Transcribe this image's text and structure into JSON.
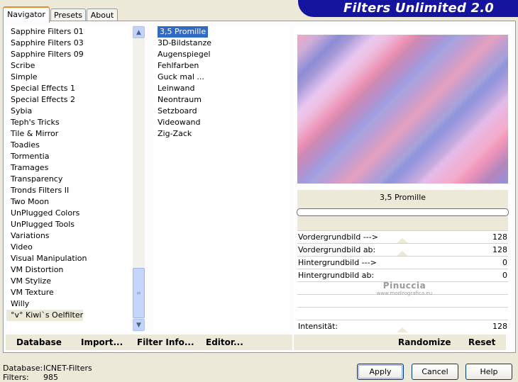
{
  "app": {
    "title": "Filters Unlimited 2.0"
  },
  "tabs": [
    {
      "label": "Navigator",
      "active": true
    },
    {
      "label": "Presets",
      "active": false
    },
    {
      "label": "About",
      "active": false
    }
  ],
  "categories": [
    "Sapphire Filters 01",
    "Sapphire Filters 03",
    "Sapphire Filters 09",
    "Scribe",
    "Simple",
    "Special Effects 1",
    "Special Effects 2",
    "Sybia",
    "Teph's Tricks",
    "Tile & Mirror",
    "Toadies",
    "Tormentia",
    "Tramages",
    "Transparency",
    "Tronds Filters II",
    "Two Moon",
    "UnPlugged Colors",
    "UnPlugged Tools",
    "Variations",
    "Video",
    "Visual Manipulation",
    "VM Distortion",
    "VM Stylize",
    "VM Texture",
    "Willy",
    "°v° Kiwi`s Oelfilter"
  ],
  "filters": [
    "3,5 Promille",
    "3D-Bildstanze",
    "Augenspiegel",
    "Fehlfarben",
    "Guck mal ...",
    "Leinwand",
    "Neontraum",
    "Setzboard",
    "Videowand",
    "Zig-Zack"
  ],
  "selected_filter": "3,5 Promille",
  "parameters": [
    {
      "label": "Vordergrundbild --->",
      "value": "128"
    },
    {
      "label": "Vordergrundbild ab:",
      "value": "128"
    },
    {
      "label": "Hintergrundbild --->",
      "value": "0"
    },
    {
      "label": "Hintergrundbild ab:",
      "value": "0"
    }
  ],
  "intensity": {
    "label": "Intensität:",
    "value": "128"
  },
  "watermark": {
    "line1": "Pinuccia",
    "line2": "www.modirografica.eu"
  },
  "bottom_buttons": {
    "database": "Database",
    "import": "Import...",
    "filter_info": "Filter Info...",
    "editor": "Editor...",
    "randomize": "Randomize",
    "reset": "Reset"
  },
  "status": {
    "database_label": "Database:",
    "database_value": "ICNET-Filters",
    "filters_label": "Filters:",
    "filters_value": "985"
  },
  "dialog_buttons": {
    "apply": "Apply",
    "cancel": "Cancel",
    "help": "Help"
  },
  "colors": {
    "banner": "#14149E",
    "selection": "#316AC5",
    "dialog_bg": "#ECE9D8"
  }
}
